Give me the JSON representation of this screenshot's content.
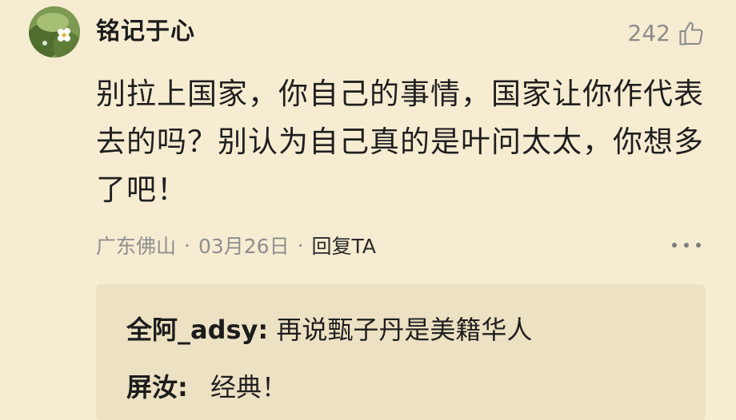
{
  "comment": {
    "username": "铭记于心",
    "like_count": "242",
    "text": "别拉上国家，你自己的事情，国家让你作代表去的吗？别认为自己真的是叶问太太，你想多了吧！",
    "location": "广东佛山",
    "date": "03月26日",
    "reply_label": "回复TA",
    "separator": "·"
  },
  "replies": [
    {
      "name": "全阿_adsy:",
      "text": "再说甄子丹是美籍华人"
    },
    {
      "name": "屏汝:",
      "text": "经典！"
    }
  ],
  "icons": {
    "like": "thumbs-up-icon",
    "more": "more-icon",
    "avatar": "avatar"
  }
}
